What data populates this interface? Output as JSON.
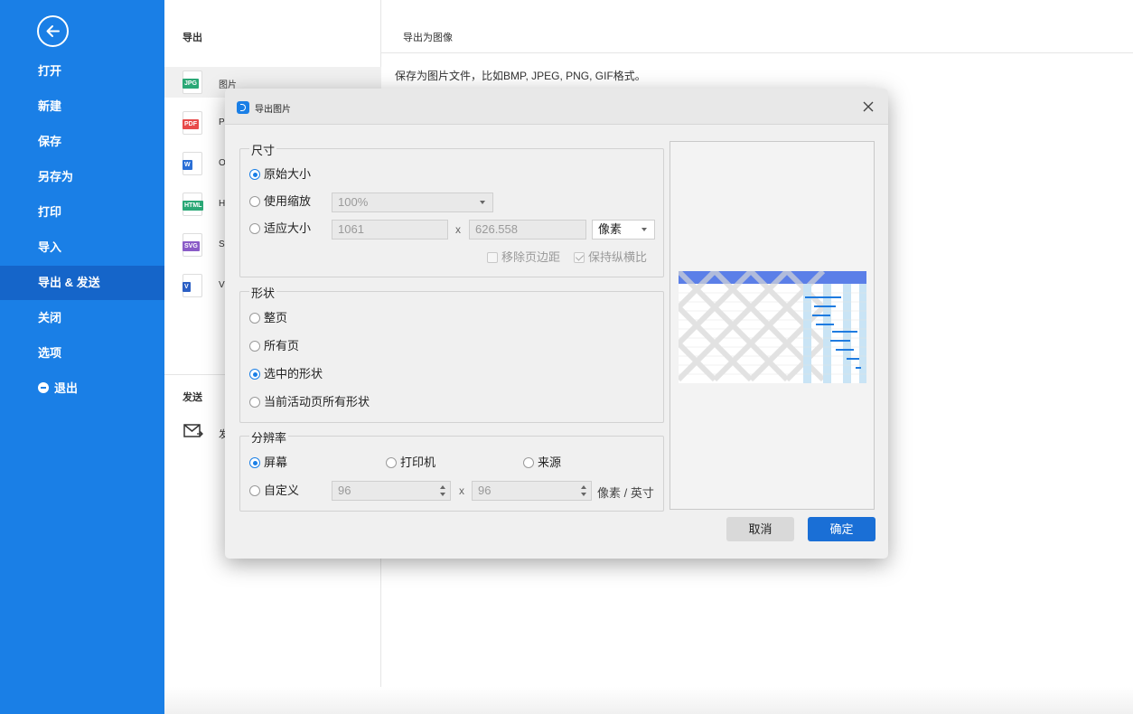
{
  "sidebar": {
    "items": [
      {
        "label": "打开"
      },
      {
        "label": "新建"
      },
      {
        "label": "保存"
      },
      {
        "label": "另存为"
      },
      {
        "label": "打印"
      },
      {
        "label": "导入"
      },
      {
        "label": "导出 & 发送",
        "active": true
      },
      {
        "label": "关闭"
      },
      {
        "label": "选项"
      },
      {
        "label": "退出"
      }
    ]
  },
  "export_panel": {
    "title": "导出",
    "items": [
      {
        "tag": "JPG",
        "tag_color": "#2aa876",
        "label": "图片"
      },
      {
        "tag": "PDF",
        "tag_color": "#e84a4a",
        "label": "P"
      },
      {
        "tag": "W",
        "tag_color": "#2b6fd6",
        "label": "O"
      },
      {
        "tag": "HTML",
        "tag_color": "#2aa876",
        "label": "H"
      },
      {
        "tag": "SVG",
        "tag_color": "#8a5cc7",
        "label": "S"
      },
      {
        "tag": "V",
        "tag_color": "#2b5fc4",
        "label": "V"
      }
    ],
    "send_title": "发送",
    "send_label": "发"
  },
  "right_panel": {
    "title": "导出为图像",
    "description": "保存为图片文件，比如BMP, JPEG, PNG, GIF格式。"
  },
  "dialog": {
    "title": "导出图片",
    "size_group": {
      "legend": "尺寸",
      "original": "原始大小",
      "scale": "使用缩放",
      "scale_value": "100%",
      "fit": "适应大小",
      "width": "1061",
      "height": "626.558",
      "times": "x",
      "unit": "像素",
      "remove_margin": "移除页边距",
      "keep_ratio": "保持纵横比"
    },
    "shape_group": {
      "legend": "形状",
      "whole_page": "整页",
      "all_pages": "所有页",
      "selected_shapes": "选中的形状",
      "active_page_shapes": "当前活动页所有形状"
    },
    "resolution_group": {
      "legend": "分辨率",
      "screen": "屏幕",
      "printer": "打印机",
      "source": "来源",
      "custom": "自定义",
      "dpi_x": "96",
      "dpi_y": "96",
      "times": "x",
      "unit": "像素 / 英寸"
    },
    "cancel": "取消",
    "ok": "确定"
  },
  "colors": {
    "sidebar_bg": "#1a7fe6",
    "sidebar_active": "#1565c9",
    "primary_button": "#1a6fd6"
  }
}
